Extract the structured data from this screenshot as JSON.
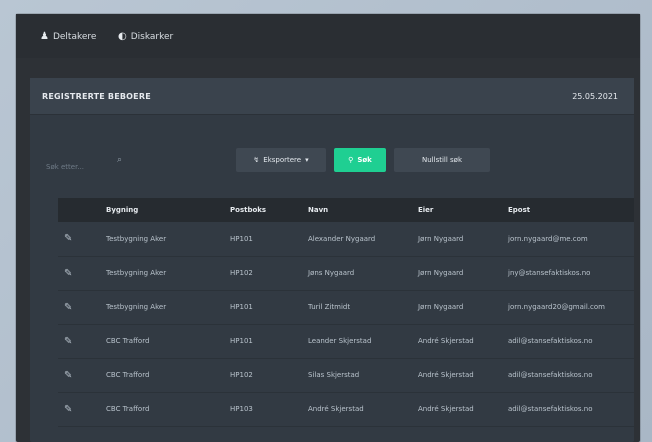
{
  "nav": {
    "items": [
      {
        "label": "Deltakere",
        "icon": "user-icon"
      },
      {
        "label": "Diskarker",
        "icon": "brightness-icon"
      }
    ]
  },
  "panel": {
    "title": "REGISTRERTE BEBOERE",
    "date": "25.05.2021"
  },
  "search": {
    "placeholder": "Søk etter..."
  },
  "toolbar": {
    "export_label": "Eksportere",
    "search_label": "Søk",
    "reset_label": "Nullstill søk"
  },
  "table": {
    "columns": [
      "",
      "Bygning",
      "Postboks",
      "Navn",
      "Eier",
      "Epost"
    ],
    "rows": [
      {
        "bygning": "Testbygning Aker",
        "postboks": "HP101",
        "navn": "Alexander Nygaard",
        "eier": "Jørn Nygaard",
        "epost": "jorn.nygaard@me.com"
      },
      {
        "bygning": "Testbygning Aker",
        "postboks": "HP102",
        "navn": "Jøns Nygaard",
        "eier": "Jørn Nygaard",
        "epost": "jny@stansefaktiskos.no"
      },
      {
        "bygning": "Testbygning Aker",
        "postboks": "HP101",
        "navn": "Turil Zitmidt",
        "eier": "Jørn Nygaard",
        "epost": "jorn.nygaard20@gmail.com"
      },
      {
        "bygning": "CBC Trafford",
        "postboks": "HP101",
        "navn": "Leander Skjerstad",
        "eier": "André Skjerstad",
        "epost": "adil@stansefaktiskos.no"
      },
      {
        "bygning": "CBC Trafford",
        "postboks": "HP102",
        "navn": "Silas Skjerstad",
        "eier": "André Skjerstad",
        "epost": "adil@stansefaktiskos.no"
      },
      {
        "bygning": "CBC Trafford",
        "postboks": "HP103",
        "navn": "André Skjerstad",
        "eier": "André Skjerstad",
        "epost": "adil@stansefaktiskos.no"
      }
    ]
  }
}
